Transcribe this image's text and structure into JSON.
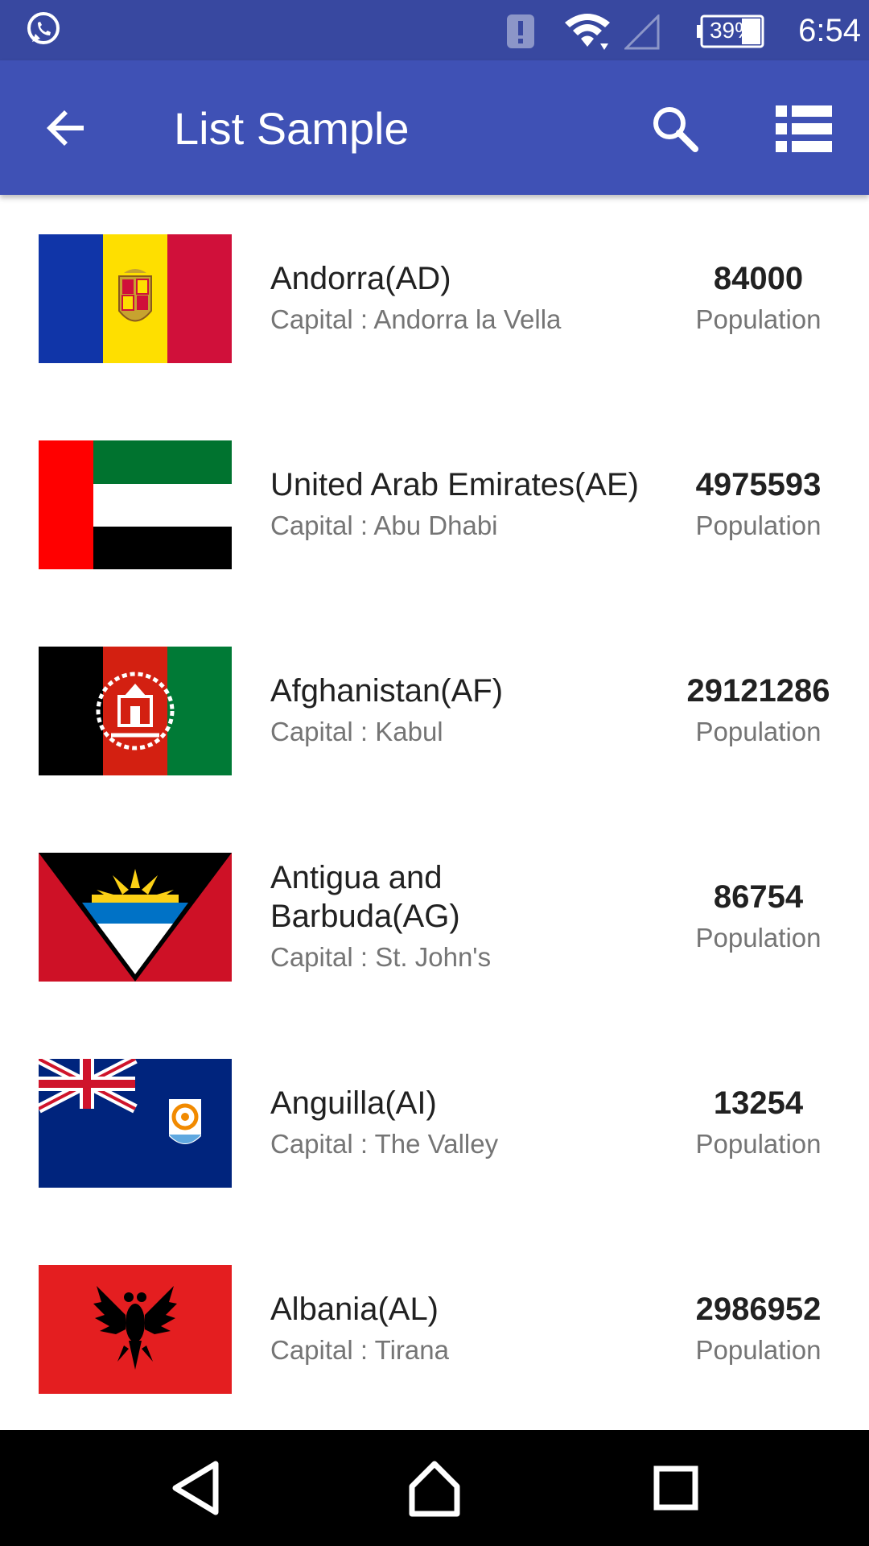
{
  "status_bar": {
    "battery_text": "39%",
    "time": "6:54",
    "icons": [
      "whatsapp-icon",
      "alert-icon",
      "wifi-icon",
      "signal-icon",
      "battery-icon"
    ]
  },
  "app_bar": {
    "title": "List Sample",
    "icons": [
      "back-arrow-icon",
      "search-icon",
      "list-view-icon"
    ],
    "color": "#3f51b5"
  },
  "countries": [
    {
      "name": "Andorra(AD)",
      "capital": "Capital : Andorra la Vella",
      "population": "84000",
      "population_label": "Population",
      "flag": "andorra-flag"
    },
    {
      "name": "United Arab Emirates(AE)",
      "capital": "Capital : Abu Dhabi",
      "population": "4975593",
      "population_label": "Population",
      "flag": "uae-flag"
    },
    {
      "name": "Afghanistan(AF)",
      "capital": "Capital : Kabul",
      "population": "29121286",
      "population_label": "Population",
      "flag": "afghanistan-flag"
    },
    {
      "name": "Antigua and Barbuda(AG)",
      "capital": "Capital : St. John's",
      "population": "86754",
      "population_label": "Population",
      "flag": "antigua-flag"
    },
    {
      "name": "Anguilla(AI)",
      "capital": "Capital : The Valley",
      "population": "13254",
      "population_label": "Population",
      "flag": "anguilla-flag"
    },
    {
      "name": "Albania(AL)",
      "capital": "Capital : Tirana",
      "population": "2986952",
      "population_label": "Population",
      "flag": "albania-flag"
    }
  ],
  "nav_bar": {
    "icons": [
      "nav-back-icon",
      "nav-home-icon",
      "nav-recent-icon"
    ]
  }
}
